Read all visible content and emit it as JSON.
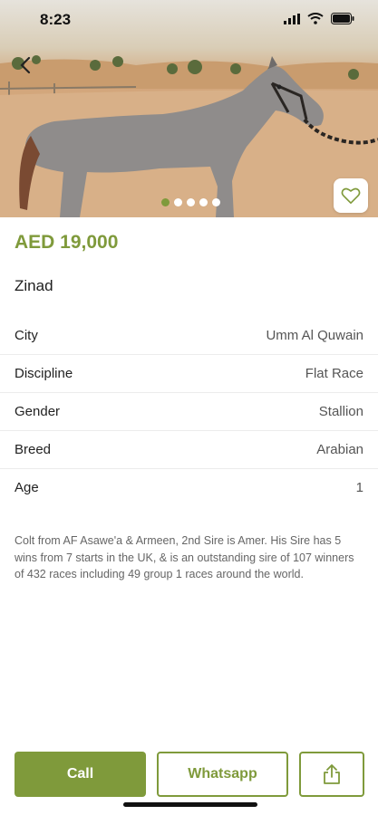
{
  "status_bar": {
    "time": "8:23"
  },
  "gallery": {
    "image_count": 5,
    "active_index": 0
  },
  "listing": {
    "price": "AED 19,000",
    "name": "Zinad",
    "specs": [
      {
        "label": "City",
        "value": "Umm Al Quwain"
      },
      {
        "label": "Discipline",
        "value": "Flat Race"
      },
      {
        "label": "Gender",
        "value": "Stallion"
      },
      {
        "label": "Breed",
        "value": "Arabian"
      },
      {
        "label": "Age",
        "value": "1"
      }
    ],
    "description": "Colt from AF Asawe'a & Armeen, 2nd Sire is Amer. His Sire has 5 wins from 7 starts in the UK, & is an outstanding sire of 107 winners of 432 races including 49 group 1 races around the world."
  },
  "actions": {
    "call_label": "Call",
    "whatsapp_label": "Whatsapp"
  },
  "icons": {
    "back": "chevron-left-icon",
    "favorite": "heart-icon",
    "share": "share-icon",
    "wifi": "wifi-icon",
    "battery": "battery-icon",
    "signal": "signal-icon"
  },
  "colors": {
    "accent": "#7f9a3b",
    "divider": "#ececec"
  }
}
